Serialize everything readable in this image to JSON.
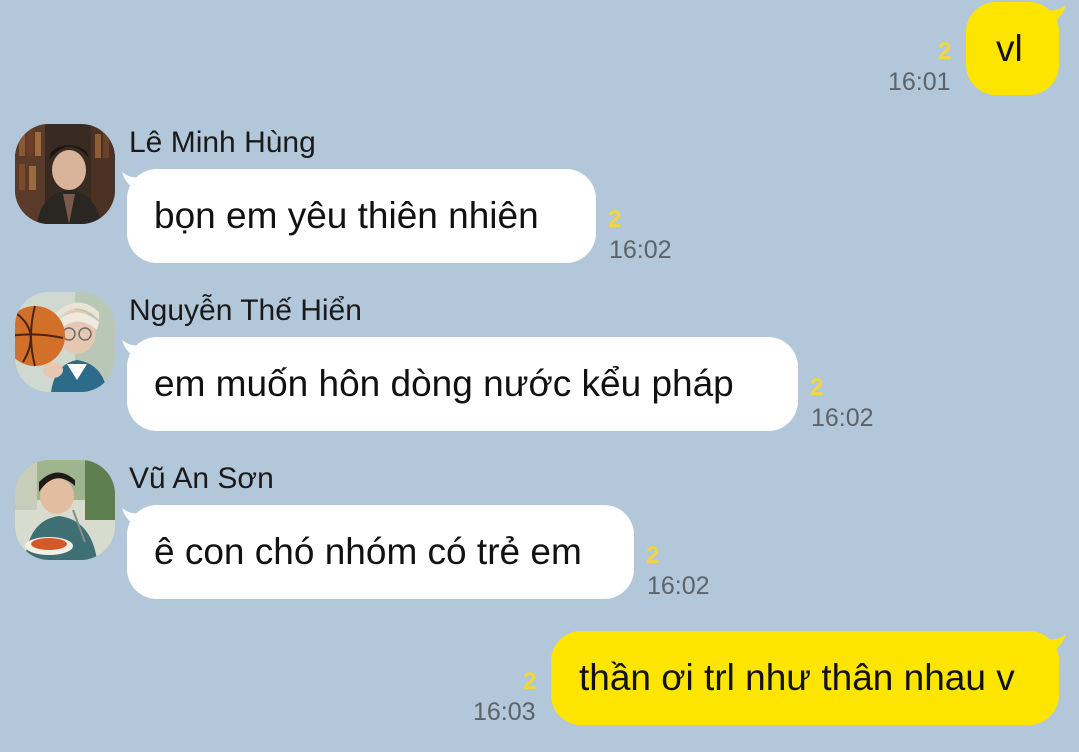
{
  "messages": [
    {
      "direction": "outgoing",
      "text": "vl",
      "unread": "2",
      "time": "16:01"
    },
    {
      "direction": "incoming",
      "sender": "Lê Minh Hùng",
      "avatar": "avatar-photo-1",
      "text": "bọn em yêu thiên nhiên",
      "unread": "2",
      "time": "16:02"
    },
    {
      "direction": "incoming",
      "sender": "Nguyễn Thế Hiển",
      "avatar": "avatar-photo-2",
      "text": "em muốn hôn dòng nước kểu pháp",
      "unread": "2",
      "time": "16:02"
    },
    {
      "direction": "incoming",
      "sender": "Vũ An Sơn",
      "avatar": "avatar-photo-3",
      "text": "ê con chó nhóm có trẻ em",
      "unread": "2",
      "time": "16:02"
    },
    {
      "direction": "outgoing",
      "text": "thần ơi trl như thân nhau v",
      "unread": "2",
      "time": "16:03"
    }
  ],
  "colors": {
    "background": "#b2c7da",
    "outgoing_bubble": "#fee500",
    "incoming_bubble": "#ffffff",
    "unread": "#f2d63a",
    "time": "#5b636b"
  }
}
